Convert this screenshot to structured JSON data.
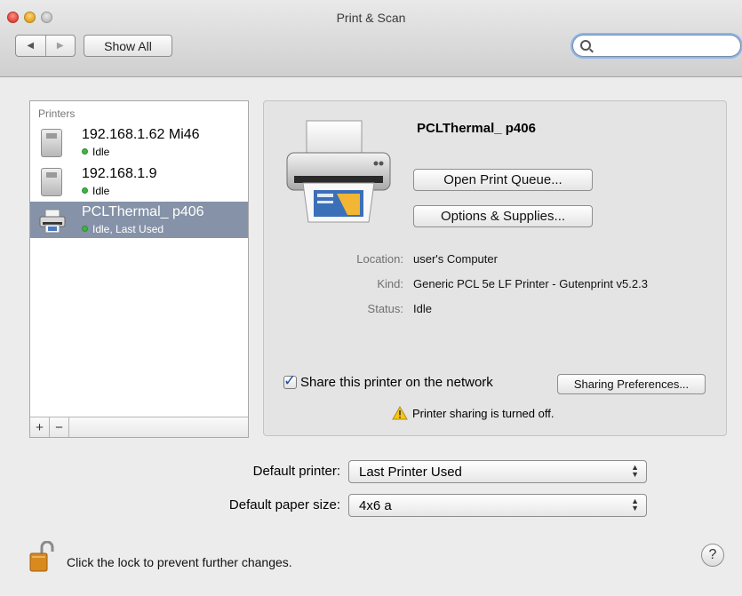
{
  "window": {
    "title": "Print & Scan"
  },
  "toolbar": {
    "back_glyph": "◀",
    "forward_glyph": "▶",
    "show_all_label": "Show All",
    "search_placeholder": ""
  },
  "printers": {
    "header": "Printers",
    "items": [
      {
        "name": "192.168.1.62  Mi46",
        "status": "Idle",
        "selected": false
      },
      {
        "name": "192.168.1.9",
        "status": "Idle",
        "selected": false
      },
      {
        "name": "PCLThermal_ p406",
        "status": "Idle, Last Used",
        "selected": true
      }
    ],
    "add_label": "+",
    "remove_label": "−"
  },
  "detail": {
    "printer_name": "PCLThermal_ p406",
    "open_queue_label": "Open Print Queue...",
    "options_label": "Options & Supplies...",
    "location_label": "Location:",
    "location_value": "user's Computer",
    "kind_label": "Kind:",
    "kind_value": "Generic PCL 5e LF Printer - Gutenprint v5.2.3",
    "status_label": "Status:",
    "status_value": "Idle",
    "share_label": "Share this printer on the network",
    "share_checked": true,
    "sharing_prefs_label": "Sharing Preferences...",
    "warning_text": "Printer sharing is turned off."
  },
  "defaults": {
    "printer_label": "Default printer:",
    "printer_value": "Last Printer Used",
    "paper_label": "Default paper size:",
    "paper_value": "4x6 a"
  },
  "footer": {
    "lock_text": "Click the lock to prevent further changes.",
    "help_label": "?"
  },
  "colors": {
    "selection": "#8592a8",
    "status_green": "#3fb541",
    "warning_yellow": "#f5c518"
  }
}
